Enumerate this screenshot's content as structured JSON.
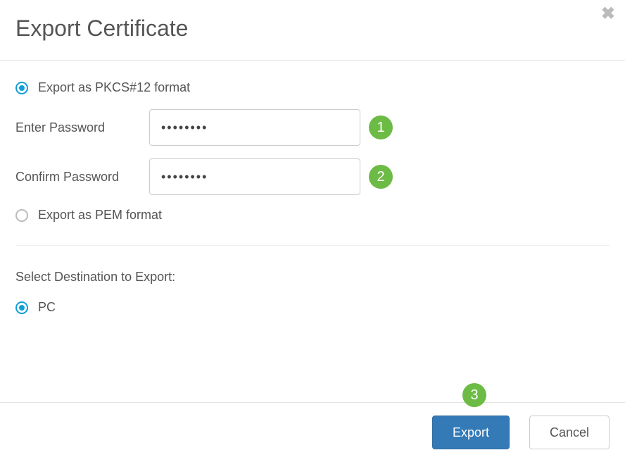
{
  "header": {
    "title": "Export Certificate"
  },
  "format": {
    "pkcs12": {
      "label": "Export as PKCS#12 format",
      "selected": true
    },
    "pem": {
      "label": "Export as PEM format",
      "selected": false
    }
  },
  "fields": {
    "enter_password": {
      "label": "Enter Password",
      "value": "••••••••"
    },
    "confirm_password": {
      "label": "Confirm Password",
      "value": "••••••••"
    }
  },
  "destination": {
    "section_label": "Select Destination to Export:",
    "pc": {
      "label": "PC",
      "selected": true
    }
  },
  "callouts": {
    "one": "1",
    "two": "2",
    "three": "3"
  },
  "footer": {
    "export_label": "Export",
    "cancel_label": "Cancel"
  },
  "icons": {
    "close": "✖"
  },
  "colors": {
    "accent": "#0f9fd7",
    "primary_btn": "#337ab7",
    "callout": "#6cbb45"
  }
}
